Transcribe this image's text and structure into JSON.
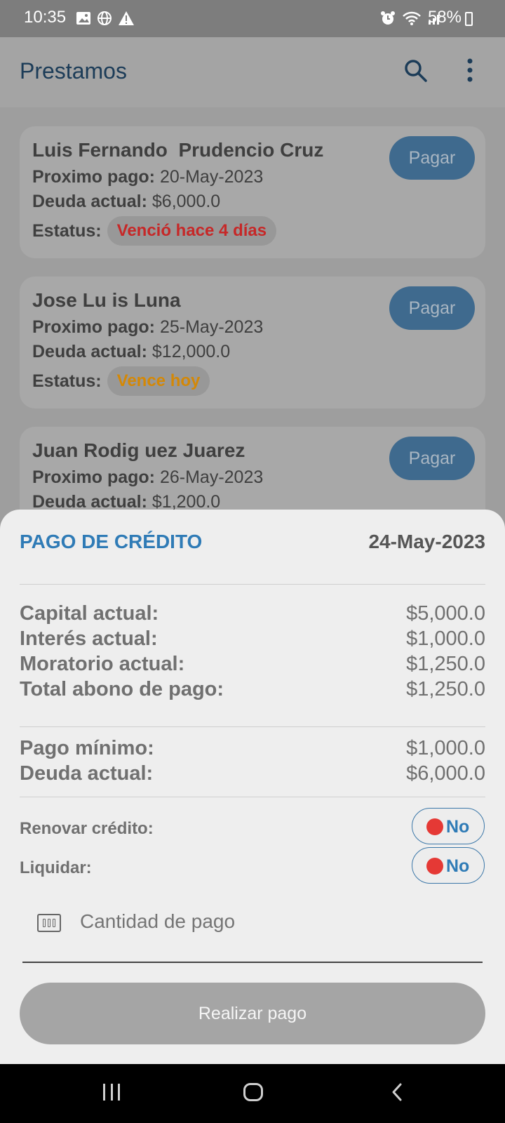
{
  "status_bar": {
    "time": "10:35",
    "battery": "58%"
  },
  "app_bar": {
    "title": "Prestamos"
  },
  "loans": [
    {
      "name": "Luis Fernando  Prudencio Cruz",
      "next_payment_label": "Proximo pago:",
      "next_payment": "20-May-2023",
      "debt_label": "Deuda actual:",
      "debt": "$6,000.0",
      "status_label": "Estatus:",
      "status": "Venció hace 4 días",
      "status_color": "#c62828",
      "pay_label": "Pagar"
    },
    {
      "name": "Jose Lu is Luna",
      "next_payment_label": "Proximo pago:",
      "next_payment": "25-May-2023",
      "debt_label": "Deuda actual:",
      "debt": "$12,000.0",
      "status_label": "Estatus:",
      "status": "Vence hoy",
      "status_color": "#d48806",
      "pay_label": "Pagar"
    },
    {
      "name": "Juan Rodig uez Juarez",
      "next_payment_label": "Proximo pago:",
      "next_payment": "26-May-2023",
      "debt_label": "Deuda actual:",
      "debt": "$1,200.0",
      "pay_label": "Pagar"
    }
  ],
  "sheet": {
    "title": "PAGO DE CRÉDITO",
    "date": "24-May-2023",
    "breakdown": [
      {
        "label": "Capital actual:",
        "value": "$5,000.0"
      },
      {
        "label": "Interés actual:",
        "value": "$1,000.0"
      },
      {
        "label": "Moratorio actual:",
        "value": "$1,250.0"
      },
      {
        "label": "Total abono de pago:",
        "value": "$1,250.0"
      }
    ],
    "summary": [
      {
        "label": "Pago mínimo:",
        "value": "$1,000.0"
      },
      {
        "label": "Deuda actual:",
        "value": "$6,000.0"
      }
    ],
    "renew_label": "Renovar crédito:",
    "renew_value": "No",
    "settle_label": "Liquidar:",
    "settle_value": "No",
    "amount_placeholder": "Cantidad de pago",
    "submit_label": "Realizar pago"
  },
  "colors": {
    "accent": "#2f7bb6",
    "toggle_off": "#e53935"
  },
  "icons": {
    "search": "search-icon",
    "more": "more-vert-icon",
    "amount": "money-icon"
  }
}
